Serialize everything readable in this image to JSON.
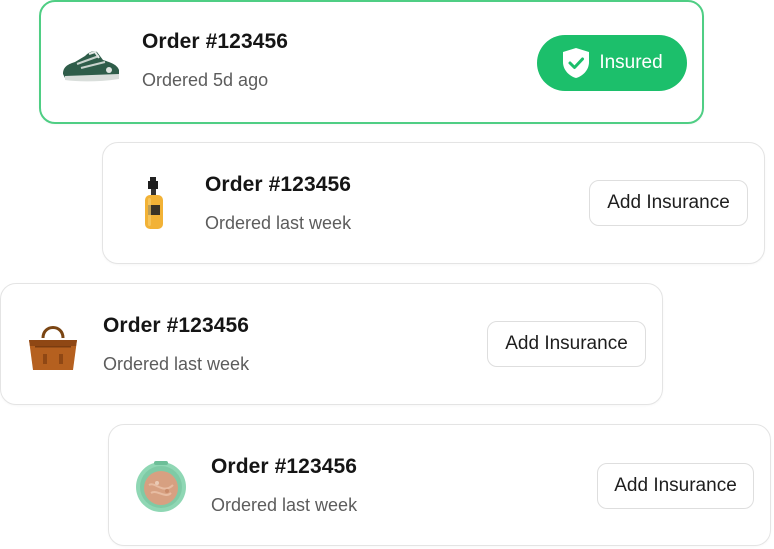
{
  "colors": {
    "accent": "#1cbf6b",
    "insured_border": "#4fce84"
  },
  "orders": [
    {
      "title": "Order #123456",
      "subtitle": "Ordered 5d ago",
      "product_icon": "sneaker-icon",
      "status": "insured",
      "button_label": "Insured",
      "button_icon": "shield-check-icon"
    },
    {
      "title": "Order #123456",
      "subtitle": "Ordered last week",
      "product_icon": "spray-bottle-icon",
      "status": "not-insured",
      "button_label": "Add Insurance"
    },
    {
      "title": "Order #123456",
      "subtitle": "Ordered last week",
      "product_icon": "handbag-icon",
      "status": "not-insured",
      "button_label": "Add Insurance"
    },
    {
      "title": "Order #123456",
      "subtitle": "Ordered last week",
      "product_icon": "compact-powder-icon",
      "status": "not-insured",
      "button_label": "Add Insurance"
    }
  ]
}
